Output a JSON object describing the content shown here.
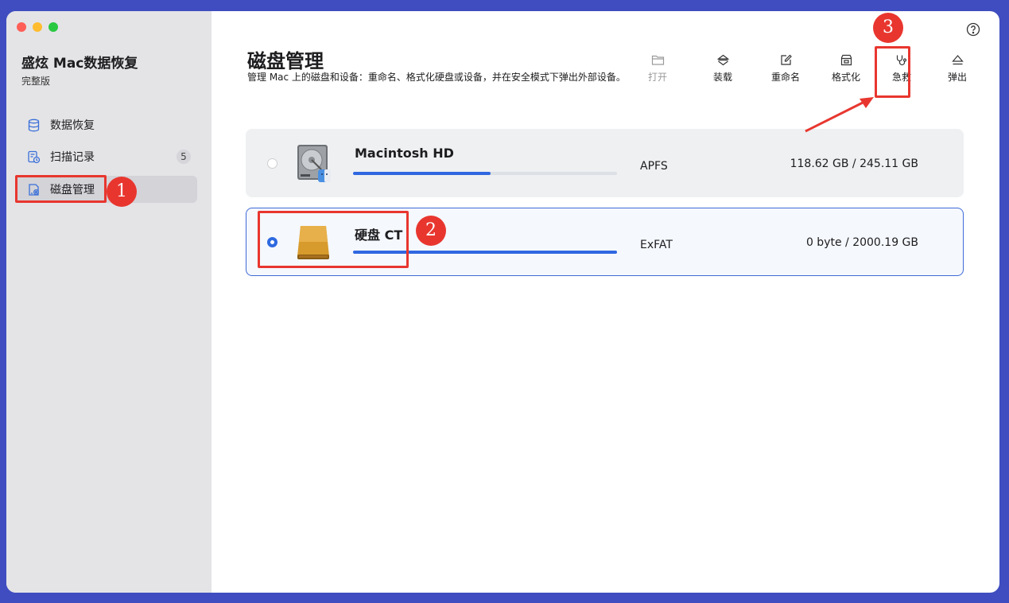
{
  "sidebar": {
    "app_title": "盛炫 Mac数据恢复",
    "edition": "完整版",
    "items": [
      {
        "label": "数据恢复",
        "icon": "database-icon"
      },
      {
        "label": "扫描记录",
        "icon": "history-icon",
        "badge": "5"
      },
      {
        "label": "磁盘管理",
        "icon": "disk-settings-icon",
        "active": true
      }
    ]
  },
  "header": {
    "title": "磁盘管理",
    "description": "管理 Mac 上的磁盘和设备：重命名、格式化硬盘或设备，并在安全模式下弹出外部设备。"
  },
  "toolbar": [
    {
      "label": "打开",
      "icon": "folder-icon",
      "enabled": false
    },
    {
      "label": "装载",
      "icon": "mount-icon",
      "enabled": true
    },
    {
      "label": "重命名",
      "icon": "rename-icon",
      "enabled": true
    },
    {
      "label": "格式化",
      "icon": "format-icon",
      "enabled": true
    },
    {
      "label": "急救",
      "icon": "stethoscope-icon",
      "enabled": true
    },
    {
      "label": "弹出",
      "icon": "eject-icon",
      "enabled": true
    }
  ],
  "disks": [
    {
      "name": "Macintosh HD",
      "filesystem": "APFS",
      "size": "118.62 GB / 245.11 GB",
      "usage_fraction": 0.52,
      "selected": false,
      "icon": "internal-drive-icon"
    },
    {
      "name": "硬盘 CT",
      "filesystem": "ExFAT",
      "size": "0 byte / 2000.19 GB",
      "usage_fraction": 1.0,
      "selected": true,
      "icon": "external-drive-icon"
    }
  ],
  "annotations": {
    "step1": "1",
    "step2": "2",
    "step3": "3"
  },
  "colors": {
    "accent": "#2f67e0",
    "annotation": "#e8362f",
    "background": "#3f4dc0"
  }
}
